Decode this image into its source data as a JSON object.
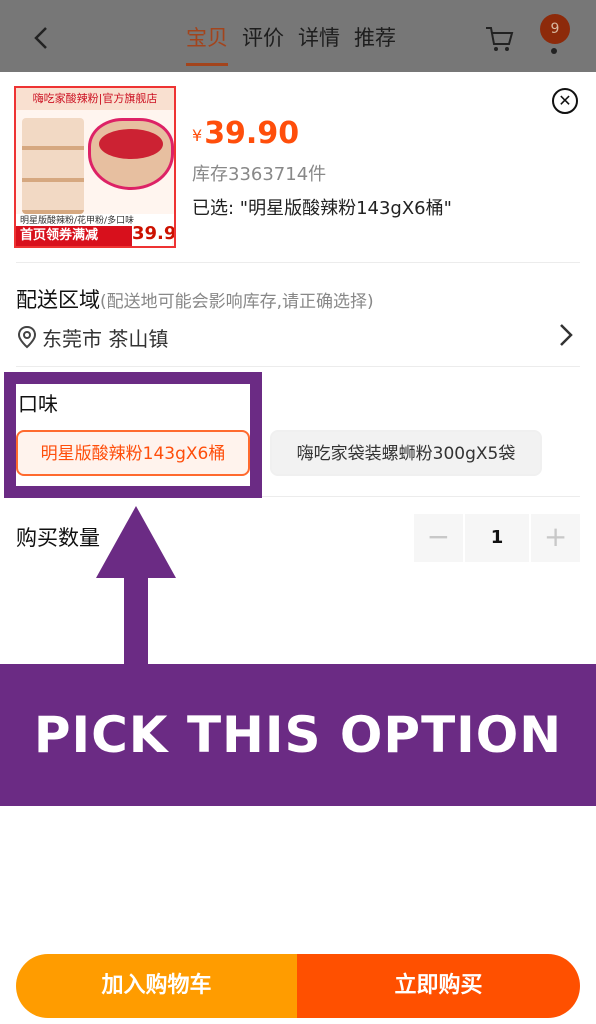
{
  "nav": {
    "back_icon": "chevron-left-icon",
    "tabs": [
      {
        "label": "宝贝",
        "active": true
      },
      {
        "label": "评价",
        "active": false
      },
      {
        "label": "详情",
        "active": false
      },
      {
        "label": "推荐",
        "active": false
      }
    ],
    "cart_icon": "cart-icon",
    "badge_count": "9"
  },
  "product": {
    "image_texts": {
      "brand_banner": "嗨吃家酸辣粉|官方旗舰店",
      "tagline": "明星版酸辣粉/花甲粉/多口味",
      "promo": "首页领券满减",
      "price_tag": "39.9"
    },
    "currency": "¥",
    "price": "39.90",
    "stock": "库存3363714件",
    "selected": "已选: \"明星版酸辣粉143gX6桶\""
  },
  "delivery": {
    "title": "配送区域",
    "hint": "(配送地可能会影响库存,请正确选择)",
    "location": "东莞市 茶山镇",
    "pin_icon": "location-pin-icon",
    "chevron_icon": "chevron-right-icon"
  },
  "flavor": {
    "title": "口味",
    "options": [
      {
        "label": "明星版酸辣粉143gX6桶",
        "selected": true
      },
      {
        "label": "嗨吃家袋装螺蛳粉300gX5袋",
        "selected": false
      }
    ]
  },
  "quantity": {
    "label": "购买数量",
    "minus": "−",
    "value": "1",
    "plus": "+"
  },
  "actions": {
    "add_to_cart": "加入购物车",
    "buy_now": "立即购买"
  },
  "annotation": {
    "banner_text": "PICK THIS OPTION",
    "color": "#6b2b84"
  },
  "colors": {
    "accent": "#ff5000",
    "price": "#ff4e0b",
    "cart_button": "#ff9c00"
  }
}
